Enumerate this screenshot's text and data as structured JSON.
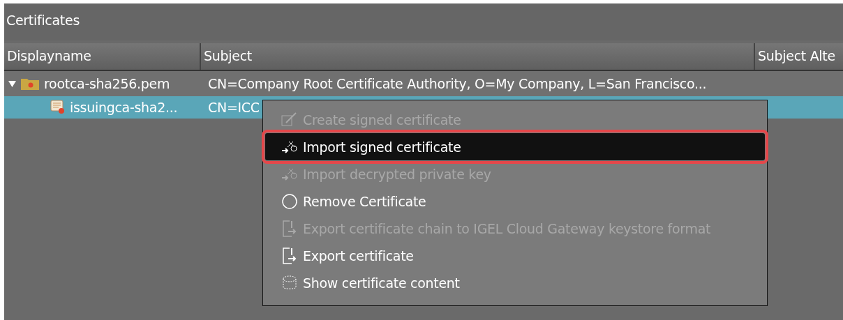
{
  "panel": {
    "title": "Certificates"
  },
  "table": {
    "columns": [
      "Displayname",
      "Subject",
      "Subject Alte"
    ],
    "rows": [
      {
        "kind": "folder",
        "expanded": true,
        "selected": false,
        "cells": [
          "rootca-sha256.pem",
          "CN=Company Root Certificate Authority, O=My Company, L=San Francisco..."
        ],
        "children": [
          {
            "kind": "certificate",
            "selected": true,
            "cells": [
              "issuingca-sha2...",
              "CN=ICC"
            ]
          }
        ]
      }
    ]
  },
  "context_menu": {
    "items": [
      {
        "kind": "create",
        "label": "Create signed certificate",
        "disabled": true,
        "selected": false
      },
      {
        "kind": "import",
        "label": "Import signed certificate",
        "disabled": false,
        "selected": true
      },
      {
        "kind": "import",
        "label": "Import decrypted private key",
        "disabled": true,
        "selected": false
      },
      {
        "kind": "remove",
        "label": "Remove Certificate",
        "disabled": false,
        "selected": false
      },
      {
        "kind": "export",
        "label": "Export certificate chain to IGEL Cloud Gateway keystore format",
        "disabled": true,
        "selected": false
      },
      {
        "kind": "export",
        "label": "Export certificate",
        "disabled": false,
        "selected": false
      },
      {
        "kind": "show",
        "label": "Show certificate content",
        "disabled": false,
        "selected": false
      }
    ]
  }
}
